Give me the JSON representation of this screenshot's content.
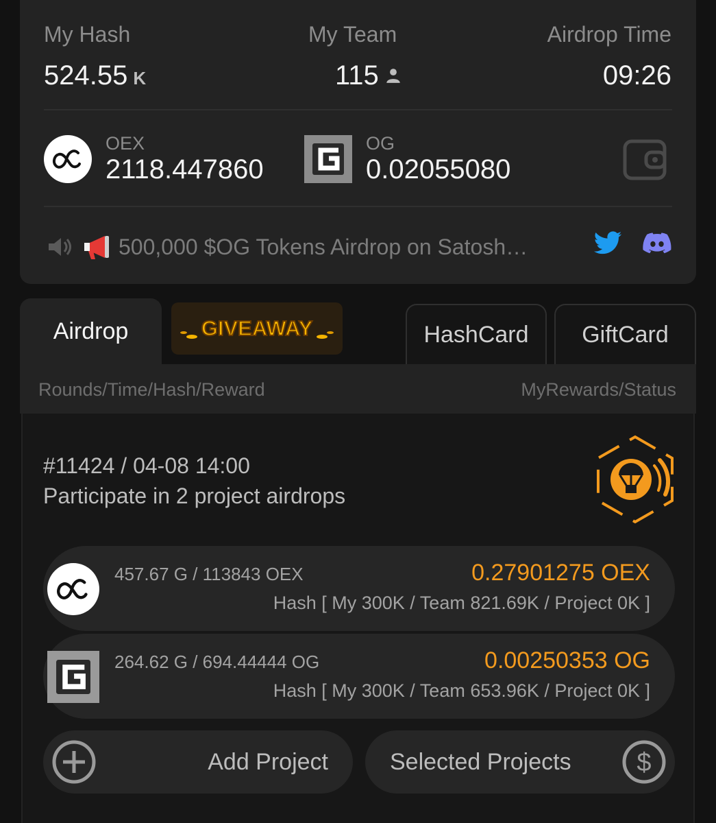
{
  "stats": {
    "hash_label": "My Hash",
    "hash_value": "524.55",
    "hash_unit": "K",
    "team_label": "My Team",
    "team_value": "115",
    "airdrop_time_label": "Airdrop Time",
    "airdrop_time_value": "09:26"
  },
  "balances": [
    {
      "symbol": "OEX",
      "amount": "2118.447860",
      "icon": "oex-logo"
    },
    {
      "symbol": "OG",
      "amount": "0.02055080",
      "icon": "og-logo"
    }
  ],
  "announcement": {
    "text": "500,000 $OG Tokens Airdrop on Satosh…",
    "icons": [
      "speaker-icon",
      "megaphone-icon"
    ],
    "social": [
      "twitter-icon",
      "discord-icon"
    ]
  },
  "tabs": [
    {
      "label": "Airdrop",
      "active": true
    },
    {
      "label": "GIVEAWAY",
      "active": false
    },
    {
      "label": "HashCard",
      "active": false
    },
    {
      "label": "GiftCard",
      "active": false
    }
  ],
  "table_header": {
    "left": "Rounds/Time/Hash/Reward",
    "right": "MyRewards/Status"
  },
  "round": {
    "title": "#11424 / 04-08 14:00",
    "subtitle": "Participate in 2 project airdrops",
    "projects": [
      {
        "amount": "457.67 G / 113843 OEX",
        "reward": "0.27901275 OEX",
        "hash": "Hash [ My 300K / Team 821.69K / Project 0K ]"
      },
      {
        "amount": "264.62 G / 694.44444 OG",
        "reward": "0.00250353 OG",
        "hash": "Hash [ My 300K / Team 653.96K / Project 0K ]"
      }
    ]
  },
  "actions": {
    "add_project": "Add Project",
    "selected_projects": "Selected Projects"
  },
  "colors": {
    "accent_orange": "#f39a1e",
    "twitter_blue": "#1d9bf0",
    "discord_purple": "#7f83f2",
    "card_bg": "#232323"
  }
}
